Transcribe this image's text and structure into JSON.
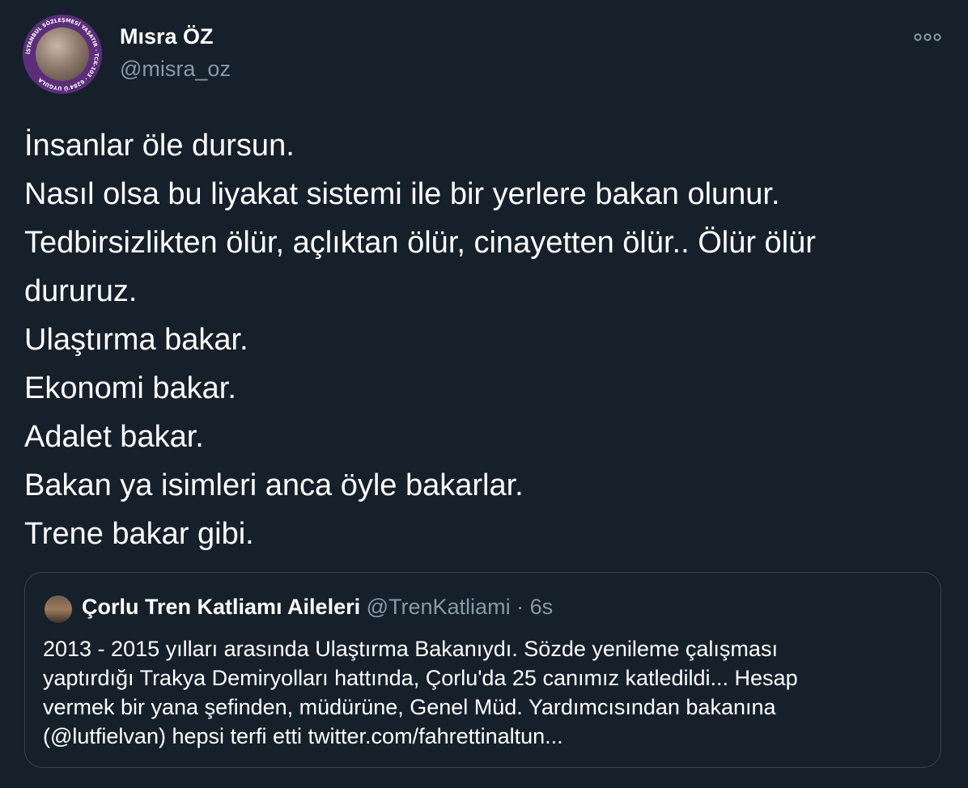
{
  "tweet": {
    "author": {
      "name": "Mısra ÖZ",
      "handle": "@misra_oz",
      "avatar_ring_text": "İSTANBUL SÖZLEŞMESİ YAŞATIR · TCK-103 · 6284'Ü UYGULA"
    },
    "more_icon": "more-horizontal-icon",
    "lines": [
      "İnsanlar öle dursun.",
      "Nasıl olsa bu liyakat sistemi ile bir yerlere bakan olunur.",
      "Tedbirsizlikten ölür, açlıktan ölür, cinayetten ölür.. Ölür ölür",
      "dururuz.",
      "Ulaştırma bakar.",
      "Ekonomi bakar.",
      "Adalet bakar.",
      "Bakan ya isimleri anca öyle bakarlar.",
      "Trene bakar gibi."
    ]
  },
  "quoted": {
    "name": "Çorlu Tren Katliamı Aileleri",
    "handle": "@TrenKatliami",
    "separator": "·",
    "time": "6s",
    "lines": [
      "2013 - 2015 yılları arasında Ulaştırma Bakanıydı. Sözde yenileme çalışması",
      "yaptırdığı Trakya Demiryolları hattında, Çorlu'da 25 canımız katledildi... Hesap",
      "vermek bir yana şefinden, müdürüne, Genel Müd. Yardımcısından bakanına",
      "(@lutfielvan) hepsi terfi etti twitter.com/fahrettinaltun..."
    ]
  },
  "colors": {
    "background": "#15202b",
    "text": "#ffffff",
    "secondary": "#8899a6",
    "border": "#38444d",
    "avatar_ring": "#5c2e7a"
  }
}
